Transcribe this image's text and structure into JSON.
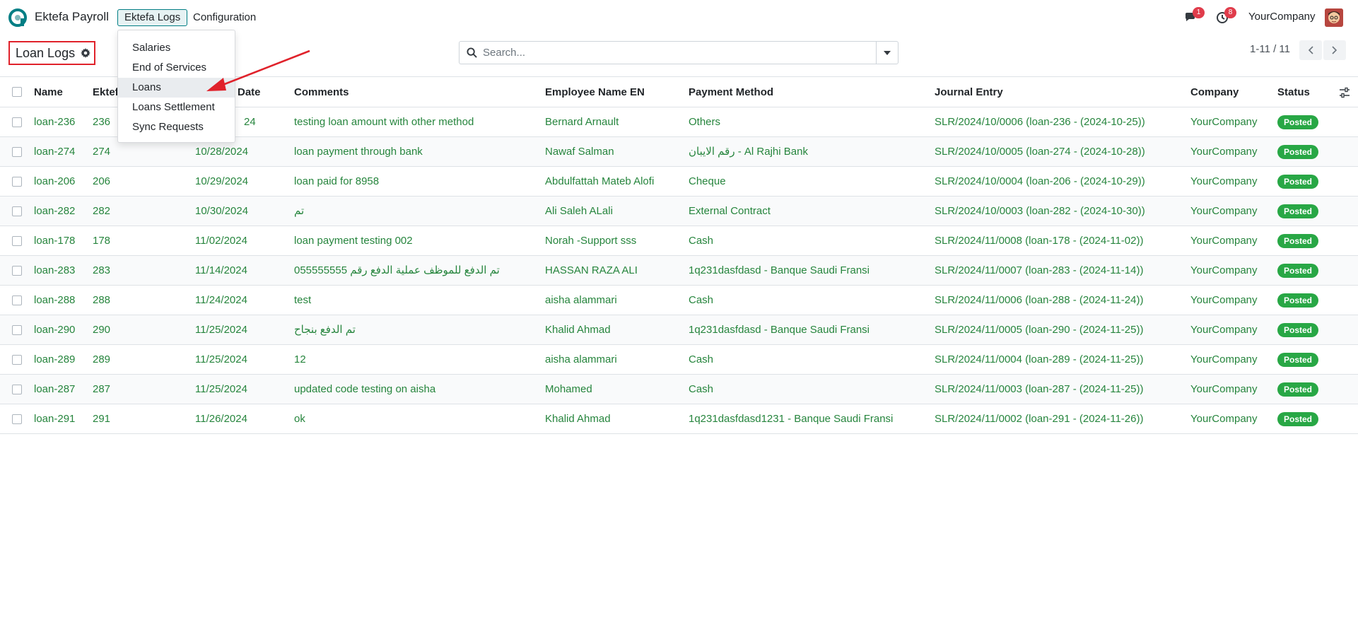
{
  "navbar": {
    "app_name": "Ektefa Payroll",
    "menu": [
      {
        "label": "Ektefa Logs",
        "active": true
      },
      {
        "label": "Configuration",
        "active": false
      }
    ],
    "messages_count": "1",
    "activities_count": "8",
    "company": "YourCompany"
  },
  "dropdown": {
    "items": [
      "Salaries",
      "End of Services",
      "Loans",
      "Loans Settlement",
      "Sync Requests"
    ],
    "hovered": "Loans"
  },
  "control_panel": {
    "title": "Loan Logs",
    "search_placeholder": "Search...",
    "pager": "1-11 / 11"
  },
  "table": {
    "columns": [
      "Name",
      "Ektef",
      "Date",
      "Comments",
      "Employee Name EN",
      "Payment Method",
      "Journal Entry",
      "Company",
      "Status"
    ],
    "rows": [
      {
        "name": "loan-236",
        "ektefa_id": "236",
        "date": "24",
        "comments": "testing loan amount with other method",
        "employee": "Bernard Arnault",
        "payment_method": "Others",
        "journal_entry": "SLR/2024/10/0006 (loan-236 - (2024-10-25))",
        "company": "YourCompany",
        "status": "Posted"
      },
      {
        "name": "loan-274",
        "ektefa_id": "274",
        "date": "10/28/2024",
        "comments": "loan payment through bank",
        "employee": "Nawaf Salman",
        "payment_method": "رقم الايبان - Al Rajhi Bank",
        "journal_entry": "SLR/2024/10/0005 (loan-274 - (2024-10-28))",
        "company": "YourCompany",
        "status": "Posted"
      },
      {
        "name": "loan-206",
        "ektefa_id": "206",
        "date": "10/29/2024",
        "comments": "loan paid for 8958",
        "employee": "Abdulfattah Mateb Alofi",
        "payment_method": "Cheque",
        "journal_entry": "SLR/2024/10/0004 (loan-206 - (2024-10-29))",
        "company": "YourCompany",
        "status": "Posted"
      },
      {
        "name": "loan-282",
        "ektefa_id": "282",
        "date": "10/30/2024",
        "comments": "تم",
        "employee": "Ali Saleh ALali",
        "payment_method": "External Contract",
        "journal_entry": "SLR/2024/10/0003 (loan-282 - (2024-10-30))",
        "company": "YourCompany",
        "status": "Posted"
      },
      {
        "name": "loan-178",
        "ektefa_id": "178",
        "date": "11/02/2024",
        "comments": "loan payment testing 002",
        "employee": "Norah -Support sss",
        "payment_method": "Cash",
        "journal_entry": "SLR/2024/11/0008 (loan-178 - (2024-11-02))",
        "company": "YourCompany",
        "status": "Posted"
      },
      {
        "name": "loan-283",
        "ektefa_id": "283",
        "date": "11/14/2024",
        "comments": "تم الدفع للموظف عملية الدفع رقم 055555555",
        "employee": "HASSAN RAZA ALI",
        "payment_method": "1q231dasfdasd - Banque Saudi Fransi",
        "journal_entry": "SLR/2024/11/0007 (loan-283 - (2024-11-14))",
        "company": "YourCompany",
        "status": "Posted"
      },
      {
        "name": "loan-288",
        "ektefa_id": "288",
        "date": "11/24/2024",
        "comments": "test",
        "employee": "aisha alammari",
        "payment_method": "Cash",
        "journal_entry": "SLR/2024/11/0006 (loan-288 - (2024-11-24))",
        "company": "YourCompany",
        "status": "Posted"
      },
      {
        "name": "loan-290",
        "ektefa_id": "290",
        "date": "11/25/2024",
        "comments": "تم الدفع بنجاح",
        "employee": "Khalid Ahmad",
        "payment_method": "1q231dasfdasd - Banque Saudi Fransi",
        "journal_entry": "SLR/2024/11/0005 (loan-290 - (2024-11-25))",
        "company": "YourCompany",
        "status": "Posted"
      },
      {
        "name": "loan-289",
        "ektefa_id": "289",
        "date": "11/25/2024",
        "comments": "12",
        "employee": "aisha alammari",
        "payment_method": "Cash",
        "journal_entry": "SLR/2024/11/0004 (loan-289 - (2024-11-25))",
        "company": "YourCompany",
        "status": "Posted"
      },
      {
        "name": "loan-287",
        "ektefa_id": "287",
        "date": "11/25/2024",
        "comments": "updated code testing on aisha",
        "employee": "Mohamed",
        "payment_method": "Cash",
        "journal_entry": "SLR/2024/11/0003 (loan-287 - (2024-11-25))",
        "company": "YourCompany",
        "status": "Posted"
      },
      {
        "name": "loan-291",
        "ektefa_id": "291",
        "date": "11/26/2024",
        "comments": "ok",
        "employee": "Khalid Ahmad",
        "payment_method": "1q231dasfdasd1231 - Banque Saudi Fransi",
        "journal_entry": "SLR/2024/11/0002 (loan-291 - (2024-11-26))",
        "company": "YourCompany",
        "status": "Posted"
      }
    ]
  },
  "colors": {
    "link_green": "#26853d",
    "status_posted": "#28a745",
    "accent": "#017e84",
    "annotation_red": "#e0222b"
  }
}
